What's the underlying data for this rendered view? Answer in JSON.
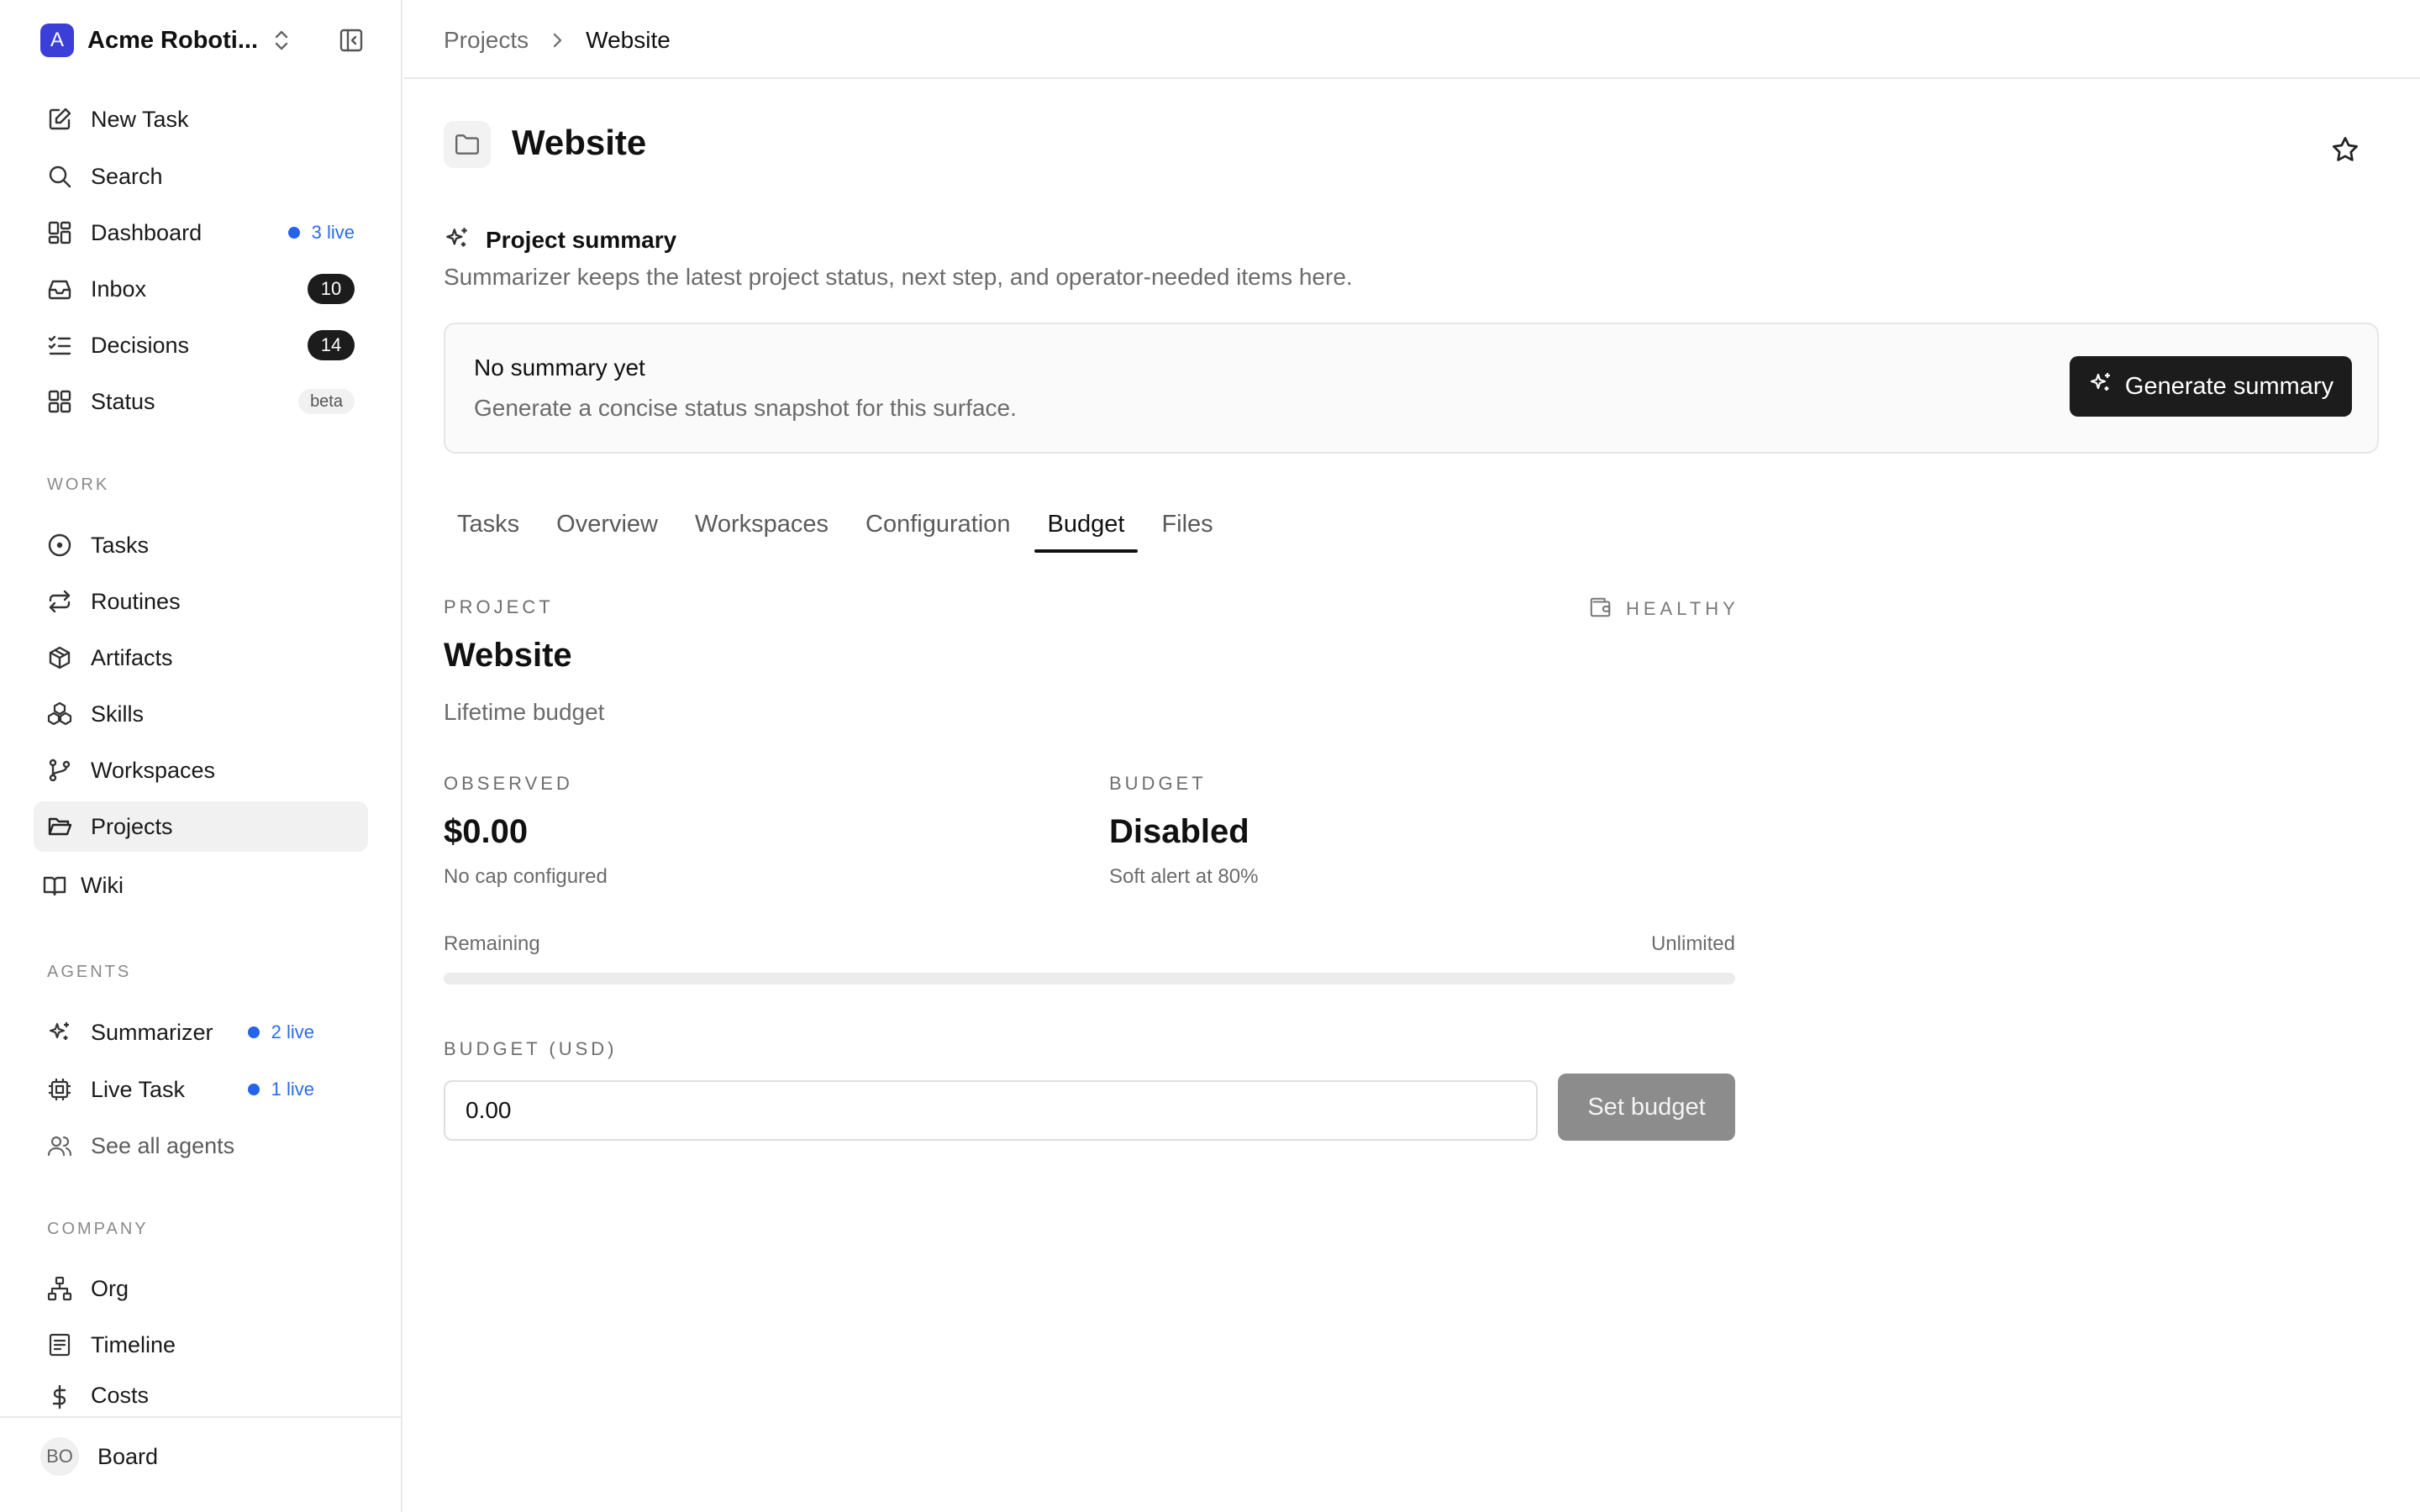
{
  "workspace": {
    "logo_letter": "A",
    "name": "Acme Roboti..."
  },
  "sidebar": {
    "top_items": [
      {
        "label": "New Task",
        "icon": "edit-icon"
      },
      {
        "label": "Search",
        "icon": "search-icon"
      },
      {
        "label": "Dashboard",
        "icon": "grid-icon",
        "live": "3 live"
      },
      {
        "label": "Inbox",
        "icon": "inbox-icon",
        "count": "10"
      },
      {
        "label": "Decisions",
        "icon": "list-check-icon",
        "count": "14"
      },
      {
        "label": "Status",
        "icon": "grid-icon",
        "badge": "beta"
      }
    ],
    "work_label": "WORK",
    "work_items": [
      {
        "label": "Tasks",
        "icon": "circle-dot-icon"
      },
      {
        "label": "Routines",
        "icon": "repeat-icon"
      },
      {
        "label": "Artifacts",
        "icon": "box-icon"
      },
      {
        "label": "Skills",
        "icon": "boxes-icon"
      },
      {
        "label": "Workspaces",
        "icon": "git-branch-icon"
      },
      {
        "label": "Projects",
        "icon": "folder-open-icon",
        "active": true
      },
      {
        "label": "Wiki",
        "icon": "book-icon"
      }
    ],
    "agents_label": "AGENTS",
    "agent_items": [
      {
        "label": "Summarizer",
        "icon": "sparkles-icon",
        "live": "2 live"
      },
      {
        "label": "Live Task",
        "icon": "cpu-icon",
        "live": "1 live"
      },
      {
        "label": "See all agents",
        "icon": "users-icon"
      }
    ],
    "company_label": "COMPANY",
    "company_items": [
      {
        "label": "Org",
        "icon": "org-chart-icon"
      },
      {
        "label": "Timeline",
        "icon": "timeline-icon"
      },
      {
        "label": "Costs",
        "icon": "dollar-icon"
      }
    ],
    "user": {
      "initials": "BO",
      "name": "Board"
    }
  },
  "breadcrumb": {
    "parent": "Projects",
    "current": "Website"
  },
  "page": {
    "title": "Website",
    "summary": {
      "title": "Project summary",
      "description": "Summarizer keeps the latest project status, next step, and operator-needed items here.",
      "card_title": "No summary yet",
      "card_description": "Generate a concise status snapshot for this surface.",
      "generate_label": "Generate summary"
    },
    "tabs": [
      "Tasks",
      "Overview",
      "Workspaces",
      "Configuration",
      "Budget",
      "Files"
    ],
    "active_tab": "Budget"
  },
  "budget": {
    "eyebrow": "PROJECT",
    "health": "HEALTHY",
    "name": "Website",
    "kind": "Lifetime budget",
    "observed_label": "OBSERVED",
    "observed_value": "$0.00",
    "observed_note": "No cap configured",
    "budget_label": "BUDGET",
    "budget_value": "Disabled",
    "budget_note": "Soft alert at 80%",
    "remaining_label": "Remaining",
    "remaining_value": "Unlimited",
    "remaining_fraction": 0,
    "input_label": "BUDGET (USD)",
    "input_value": "0.00",
    "set_label": "Set budget"
  }
}
